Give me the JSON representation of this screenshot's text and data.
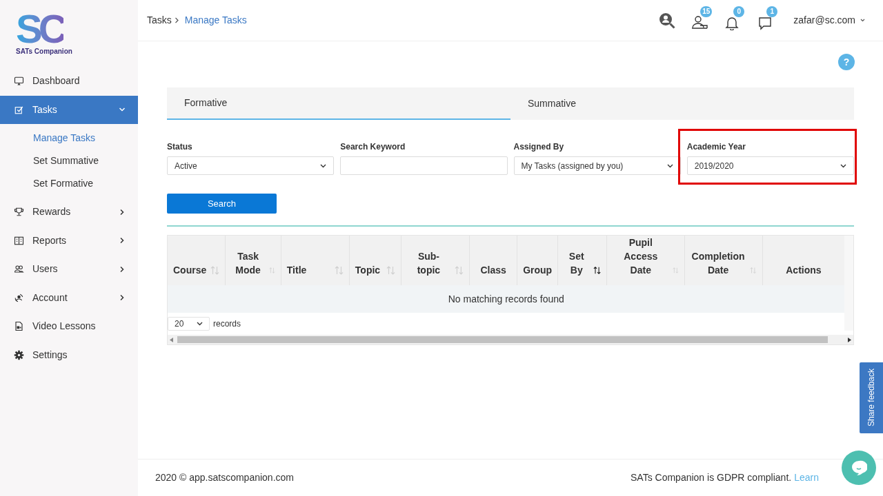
{
  "logo": {
    "mark": "SC",
    "name": "SATs Companion"
  },
  "sidebar": {
    "items": [
      {
        "label": "Dashboard",
        "selected": false
      },
      {
        "label": "Tasks",
        "selected": true,
        "expanded": true,
        "children": [
          {
            "label": "Manage Tasks",
            "selected": true
          },
          {
            "label": "Set Summative",
            "selected": false
          },
          {
            "label": "Set Formative",
            "selected": false
          }
        ]
      },
      {
        "label": "Rewards",
        "selected": false,
        "expanded": false
      },
      {
        "label": "Reports",
        "selected": false,
        "expanded": false
      },
      {
        "label": "Users",
        "selected": false,
        "expanded": false
      },
      {
        "label": "Account",
        "selected": false,
        "expanded": false
      },
      {
        "label": "Video Lessons",
        "selected": false
      },
      {
        "label": "Settings",
        "selected": false
      }
    ]
  },
  "breadcrumb": [
    "Tasks",
    "Manage Tasks"
  ],
  "header": {
    "badges": [
      {
        "count": "15"
      },
      {
        "count": "0"
      },
      {
        "count": "1"
      }
    ],
    "user": "zafar@sc.com"
  },
  "help": "?",
  "tabs": [
    {
      "label": "Formative",
      "selected": true
    },
    {
      "label": "Summative",
      "selected": false
    }
  ],
  "filters": [
    {
      "label": "Status",
      "kind": "select",
      "value": "Active",
      "highlighted": false
    },
    {
      "label": "Search Keyword",
      "kind": "text",
      "highlighted": false
    },
    {
      "label": "Assigned By",
      "kind": "select",
      "value": "My Tasks (assigned by you)",
      "highlighted": false
    },
    {
      "label": "Academic Year",
      "kind": "select",
      "value": "2019/2020",
      "highlighted": true
    }
  ],
  "search_button": "Search",
  "table": {
    "columns": [
      {
        "label": "Course",
        "sortable": true,
        "sorted": false
      },
      {
        "label": "Task Mode",
        "sortable": true,
        "sorted": false
      },
      {
        "label": "Title",
        "sortable": true,
        "sorted": false
      },
      {
        "label": "Topic",
        "sortable": true,
        "sorted": false
      },
      {
        "label": "Sub-topic",
        "sortable": true,
        "sorted": false
      },
      {
        "label": "Class",
        "sortable": false
      },
      {
        "label": "Group",
        "sortable": false
      },
      {
        "label": "Set By",
        "sortable": true,
        "sorted": true
      },
      {
        "label": "Pupil Access Date",
        "sortable": true,
        "sorted": false
      },
      {
        "label": "Completion Date",
        "sortable": true,
        "sorted": false
      },
      {
        "label": "Actions",
        "sortable": false
      }
    ],
    "empty_message": "No matching records found",
    "page_size": "20",
    "page_size_label": "records"
  },
  "footer": {
    "copyright": "2020 © app.satscompanion.com",
    "gdpr": "SATs Companion is GDPR compliant.",
    "link": "Learn"
  },
  "feedback_tab": "Share feedback"
}
